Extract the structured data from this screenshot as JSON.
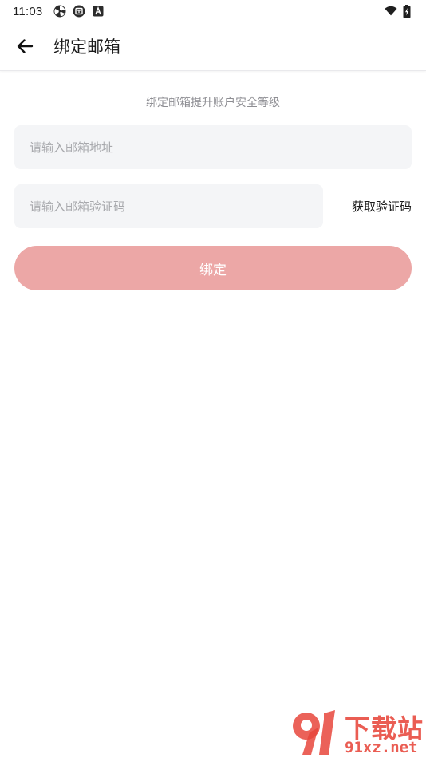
{
  "status_bar": {
    "time": "11:03",
    "left_icons": [
      "pinwheel-icon",
      "app-badge-icon",
      "a-badge-icon"
    ],
    "right_icons": [
      "wifi-icon",
      "battery-icon"
    ]
  },
  "app_bar": {
    "back_icon": "arrow-left-icon",
    "title": "绑定邮箱"
  },
  "form": {
    "hint": "绑定邮箱提升账户安全等级",
    "email_placeholder": "请输入邮箱地址",
    "email_value": "",
    "code_placeholder": "请输入邮箱验证码",
    "code_value": "",
    "get_code_label": "获取验证码",
    "bind_label": "绑定"
  },
  "watermark": {
    "top_text": "下载站",
    "bottom_text": "91xz.net"
  },
  "colors": {
    "bind_button": "#eca7a6",
    "input_bg": "#f4f5f7",
    "hint_text": "#8e8e93",
    "watermark_red": "#e8473c"
  }
}
